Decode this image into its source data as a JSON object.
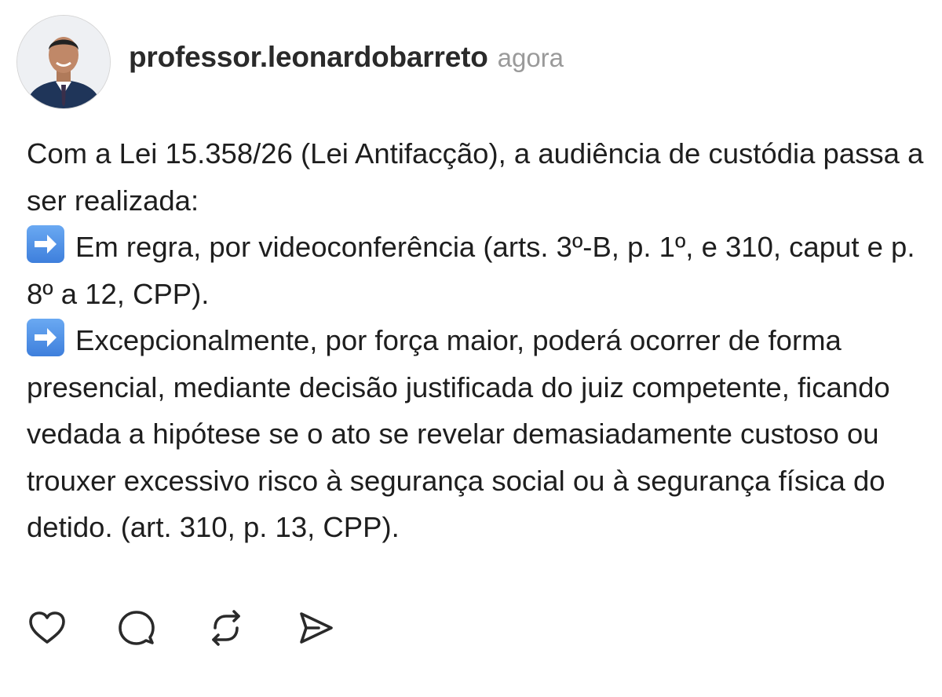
{
  "post": {
    "username": "professor.leonardobarreto",
    "timestamp": "agora",
    "intro": "Com a Lei 15.358/26 (Lei Antifacção), a audiência de custódia passa a ser realizada:",
    "bullets": [
      {
        "icon": "right-arrow-icon",
        "text": "Em regra, por videoconferência (arts. 3º-B, p. 1º, e 310, caput e p. 8º a 12, CPP)."
      },
      {
        "icon": "right-arrow-icon",
        "text": "Excepcionalmente, por força maior, poderá ocorrer de forma presencial, mediante decisão justificada do juiz competente, ficando vedada a hipótese se o ato se revelar demasiadamente custoso ou trouxer excessivo risco à segurança social ou à segurança física do detido. (art. 310, p. 13, CPP)."
      }
    ]
  },
  "actions": [
    "heart-icon",
    "comment-icon",
    "repost-icon",
    "share-icon"
  ],
  "colors": {
    "text": "#1e1e1e",
    "muted": "#9a9a9a",
    "arrow": "#4a8de6"
  }
}
